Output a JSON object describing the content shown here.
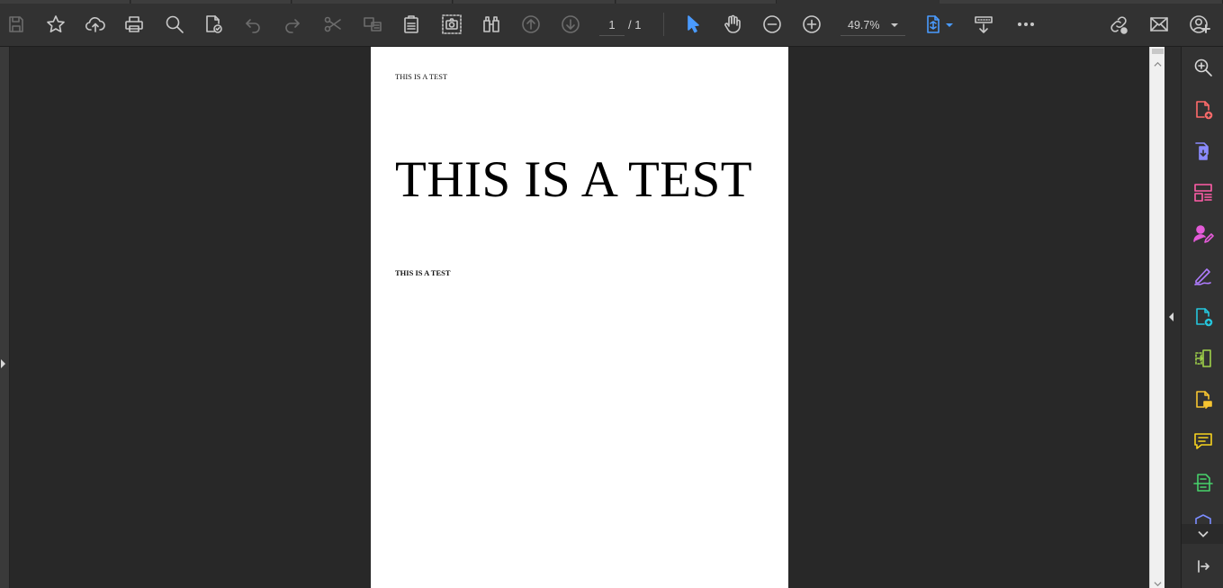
{
  "toolbar": {
    "page_current": "1",
    "page_total_text": "/ 1",
    "zoom": "49.7%"
  },
  "document": {
    "line_small": "THIS IS A TEST",
    "line_big": "THIS IS A TEST",
    "line_bold": "THIS IS A TEST"
  },
  "colors": {
    "toolbar_bg": "#323232",
    "canvas_bg": "#282828",
    "accent_blue": "#4a9bff"
  },
  "icons": {
    "toolbar": [
      "save-icon",
      "star-icon",
      "cloud-upload-icon",
      "print-icon",
      "search-icon",
      "protect-pdf-icon",
      "undo-icon",
      "redo-icon",
      "cut-icon",
      "copy-icon",
      "paste-icon",
      "snapshot-icon",
      "compare-icon",
      "page-up-icon",
      "page-down-icon",
      "select-tool-icon",
      "hand-tool-icon",
      "zoom-out-icon",
      "zoom-in-icon",
      "fit-page-icon",
      "scroll-mode-icon",
      "more-icon",
      "share-link-icon",
      "email-icon",
      "account-icon"
    ],
    "right_panel": [
      "search-zoom-icon",
      "create-pdf-icon",
      "export-pdf-icon",
      "organize-pages-icon",
      "request-signature-icon",
      "fill-sign-icon",
      "edit-pdf-icon",
      "combine-files-icon",
      "send-for-review-icon",
      "comment-icon",
      "scan-ocr-icon",
      "protect-icon"
    ]
  }
}
